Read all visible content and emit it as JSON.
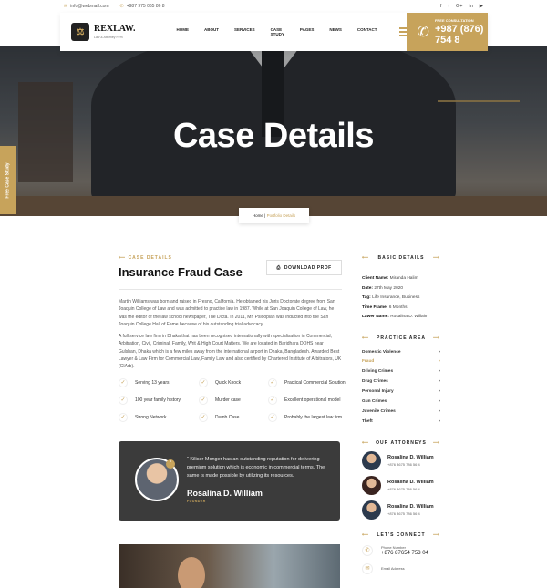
{
  "topbar": {
    "email": "info@webmail.com",
    "phone": "+987 975 065 86 8",
    "social": [
      "f",
      "t",
      "G+",
      "in",
      "▶"
    ]
  },
  "header": {
    "logo_title": "REXLAW.",
    "logo_sub": "Law & Attorney Firm",
    "menu": [
      "HOME",
      "ABOUT",
      "SERVICES",
      "CASE STUDY",
      "PAGES",
      "NEWS",
      "CONTACT"
    ],
    "cta_label": "FREE CONSULTATION",
    "cta_phone": "+987 (876) 754 8"
  },
  "hero": {
    "title": "Case Details",
    "crumb_home": "Home",
    "crumb_current": "Portfolio Details"
  },
  "sidetab": "Free Case Study",
  "main": {
    "kicker": "CASE DETAILS",
    "title": "Insurance Fraud Case",
    "download": "DOWNLOAD PROF",
    "p1": "Martin Williams was born and raised in Fresno, California. He obtained his Juris Doctorate degree from San Joaquin College of Law and was admitted to practice law in 1987. While at San Joaquin College of Law, he was the editor of the law school newspaper, The Dicta. In 2011, Mr. Psloopian was inducted into the San Joaquin College Hall of Fame because of his outstanding trial advocacy.",
    "p2": "A full service law firm in Dhaka that has been recognised internationally with specialisation in Commercial, Arbitration, Civil, Criminal, Family, Writ & High Court Matters. We are located in Baridhara DOHS near Gulshan, Dhaka which is a few miles away from the international airport in Dhaka, Bangladesh. Awarded Best Lawyer & Law Firm for Commercial Law, Family Law and also certified by Chartered Institute of Arbitrators, UK (CIArb).",
    "features": [
      "Serving 13 years",
      "Quick Knock",
      "Practical Commercial Solution",
      "100 year family history",
      "Murder case",
      "Excellent operational model",
      "Strong Network",
      "Dumb Case",
      "Probably the largest law firm"
    ],
    "quote": {
      "text": "“ Kiliser Monger has an outstanding reputation for delivering premium solution which is economic in commercial terms. The same is made possible by utilizing its resources.",
      "name": "Rosalina D. William",
      "role": "FOUNDER"
    }
  },
  "sidebar": {
    "basic_title": "BASIC DETAILS",
    "details": [
      {
        "k": "Client Name:",
        "v": "Miranda Halim"
      },
      {
        "k": "Date:",
        "v": "27th May 2020"
      },
      {
        "k": "Tag:",
        "v": "Life Insurance, Business"
      },
      {
        "k": "Time Frame:",
        "v": "6 Months"
      },
      {
        "k": "Lawer Name:",
        "v": "Rosalina D. Willaim"
      }
    ],
    "practice_title": "PRACTICE AREA",
    "practice": [
      "Domestic Violence",
      "Fraud",
      "Driving Crimes",
      "Drug Crimes",
      "Personal Injury",
      "Gun Crimes",
      "Juvenile Crimes",
      "Theft"
    ],
    "attorneys_title": "OUR ATTORNEYS",
    "attorneys": [
      {
        "name": "Rosalina D. William",
        "phone": "+876 8675 786 56 4"
      },
      {
        "name": "Rosalina D. William",
        "phone": "+876 8675 786 56 4"
      },
      {
        "name": "Rosalina D. William",
        "phone": "+876 8675 786 56 4"
      }
    ],
    "connect_title": "LET'S CONNECT",
    "phone_label": "Phone Number",
    "phone": "+876 87654 753 04",
    "email_label": "Email Address"
  },
  "colors": {
    "accent": "#c7a35b",
    "dark": "#3b3b3b"
  }
}
